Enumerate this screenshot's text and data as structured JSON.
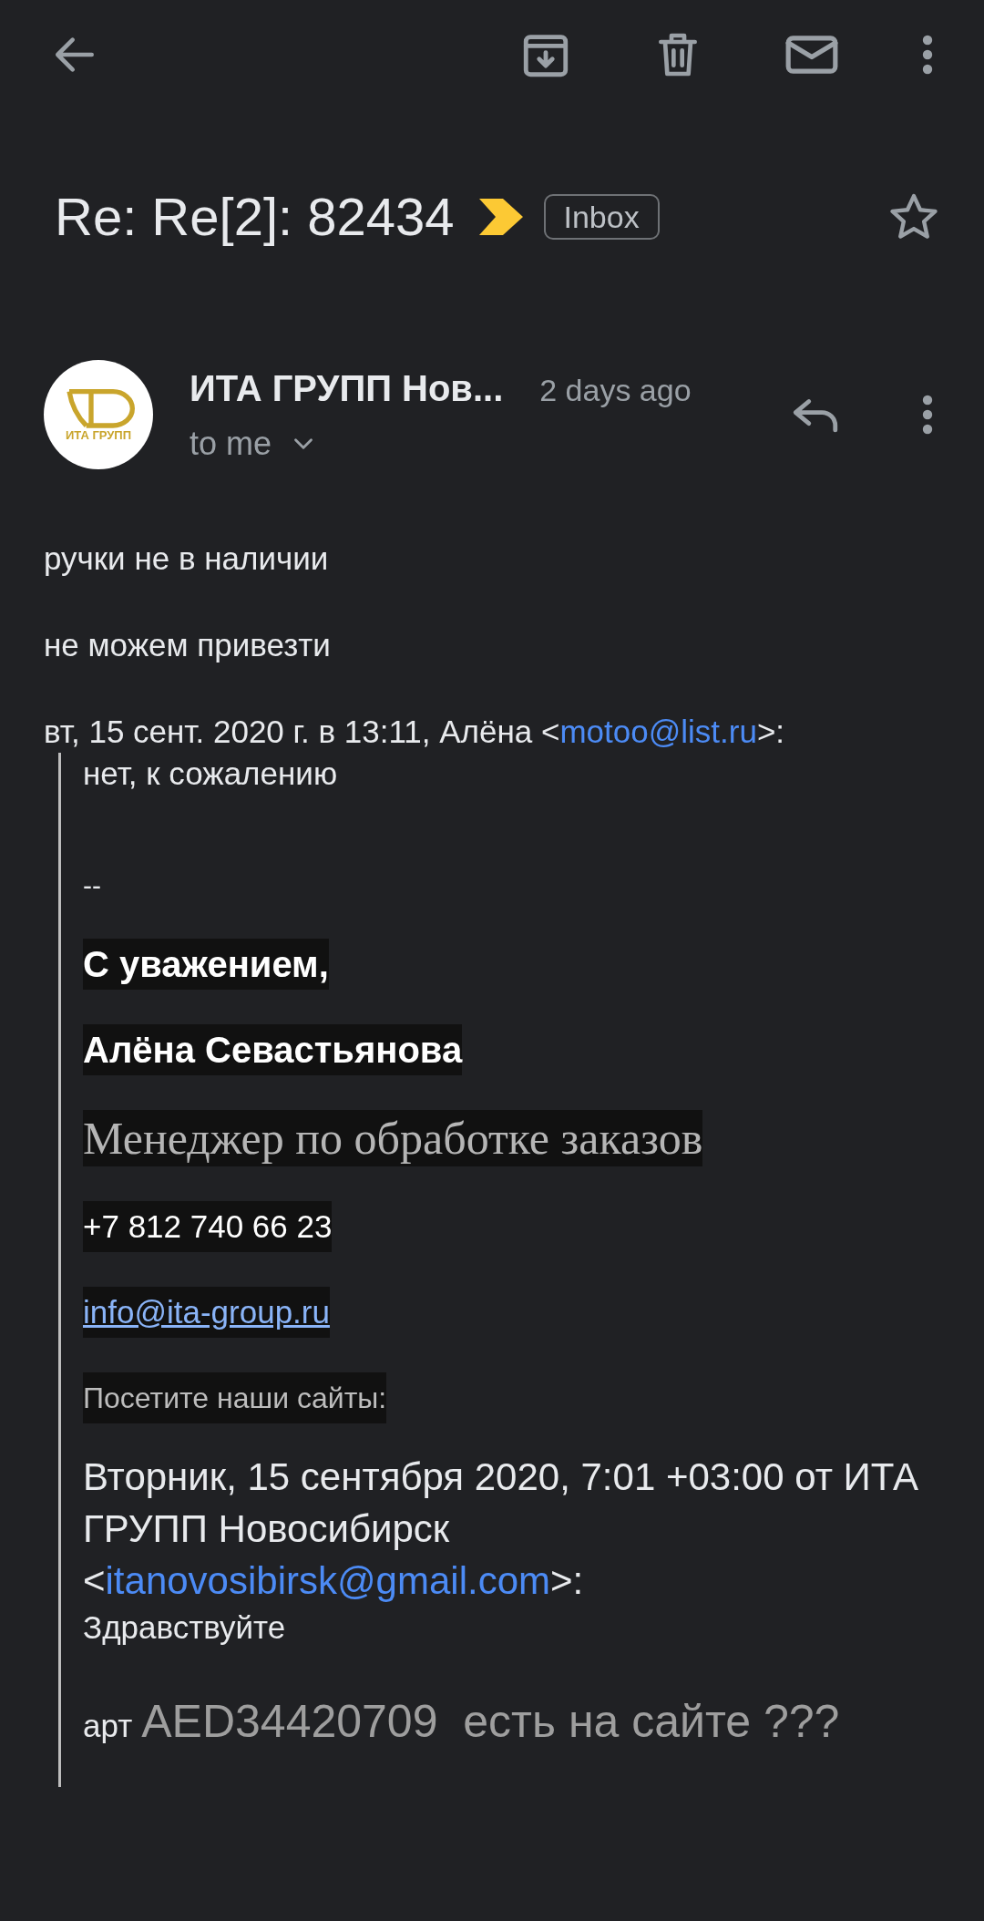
{
  "subject": {
    "title": "Re: Re[2]: 82434",
    "important": true,
    "label": "Inbox",
    "starred": false
  },
  "sender": {
    "avatar_text": "ИТА ГРУПП",
    "name": "ИТА ГРУПП Нов...",
    "time": "2 days ago",
    "recipient": "to me"
  },
  "body": [
    {
      "kind": "text",
      "text": "ручки не в наличии"
    },
    {
      "kind": "text",
      "text": "не можем привезти"
    },
    {
      "kind": "attribution",
      "before": "вт, 15 сент. 2020 г. в 13:11, Алёна <",
      "link": "motoo@list.ru",
      "after": ">:"
    }
  ],
  "quote": [
    {
      "kind": "text",
      "text": "нет, к сожалению"
    },
    {
      "kind": "separator",
      "text": "--"
    },
    {
      "kind": "sig_bold",
      "text": "С уважением,"
    },
    {
      "kind": "sig_bold",
      "text": "Алёна Севастьянова"
    },
    {
      "kind": "sig_serif",
      "text": "Менеджер по обработке заказов"
    },
    {
      "kind": "sig_plain",
      "text": "+7 812 740 66 23"
    },
    {
      "kind": "sig_link",
      "text": "info@ita-group.ru"
    },
    {
      "kind": "sig_small",
      "text": "Посетите наши сайты:"
    },
    {
      "kind": "attribution",
      "before": "Вторник, 15 сентября 2020, 7:01 +03:00 от ИТА ГРУПП Новосибирск <",
      "link": "itanovosibirsk@gmail.com",
      "after": ">:"
    },
    {
      "kind": "text",
      "text": "Здравствуйте"
    },
    {
      "kind": "art",
      "prefix": "арт",
      "text": "AED34420709  есть на сайте ???"
    }
  ]
}
